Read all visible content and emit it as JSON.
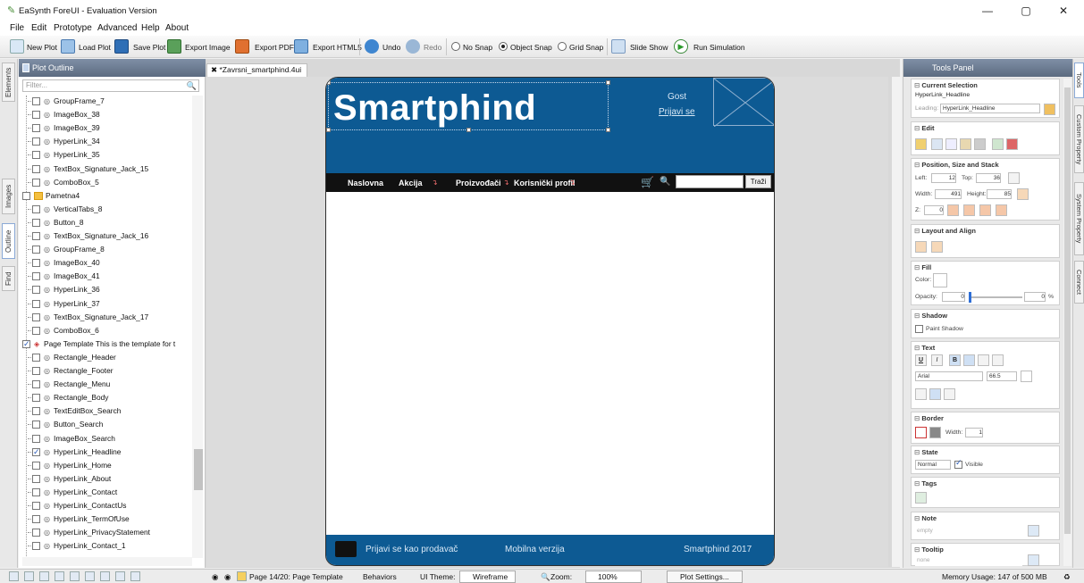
{
  "window": {
    "app_title": "EaSynth ForeUI - Evaluation Version",
    "minimize": "—",
    "maximize": "▢",
    "close": "✕"
  },
  "menu": [
    "File",
    "Edit",
    "Prototype",
    "Advanced",
    "Help",
    "About"
  ],
  "toolbar": {
    "new_plot": "New Plot",
    "load_plot": "Load Plot",
    "save_plot": "Save Plot",
    "export_image": "Export Image",
    "export_pdf": "Export PDF",
    "export_html5": "Export HTML5",
    "undo": "Undo",
    "redo": "Redo",
    "no_snap": "No Snap",
    "object_snap": "Object Snap",
    "grid_snap": "Grid Snap",
    "snap_selected": "Object Snap",
    "slide_show": "Slide Show",
    "run_simulation": "Run Simulation"
  },
  "left_tabs": [
    "Elements",
    "Images",
    "Outline",
    "Find"
  ],
  "outline": {
    "title": "Plot Outline",
    "filter_placeholder": "Filter...",
    "items": [
      {
        "label": "GroupFrame_7",
        "level": 1,
        "checked": false,
        "kind": "el"
      },
      {
        "label": "ImageBox_38",
        "level": 1,
        "checked": false,
        "kind": "el"
      },
      {
        "label": "ImageBox_39",
        "level": 1,
        "checked": false,
        "kind": "el"
      },
      {
        "label": "HyperLink_34",
        "level": 1,
        "checked": false,
        "kind": "el"
      },
      {
        "label": "HyperLink_35",
        "level": 1,
        "checked": false,
        "kind": "el"
      },
      {
        "label": "TextBox_Signature_Jack_15",
        "level": 1,
        "checked": false,
        "kind": "el"
      },
      {
        "label": "ComboBox_5",
        "level": 1,
        "checked": false,
        "kind": "el"
      },
      {
        "label": "Pametna4",
        "level": 0,
        "checked": false,
        "kind": "page"
      },
      {
        "label": "VerticalTabs_8",
        "level": 1,
        "checked": false,
        "kind": "el"
      },
      {
        "label": "Button_8",
        "level": 1,
        "checked": false,
        "kind": "el"
      },
      {
        "label": "TextBox_Signature_Jack_16",
        "level": 1,
        "checked": false,
        "kind": "el"
      },
      {
        "label": "GroupFrame_8",
        "level": 1,
        "checked": false,
        "kind": "el"
      },
      {
        "label": "ImageBox_40",
        "level": 1,
        "checked": false,
        "kind": "el"
      },
      {
        "label": "ImageBox_41",
        "level": 1,
        "checked": false,
        "kind": "el"
      },
      {
        "label": "HyperLink_36",
        "level": 1,
        "checked": false,
        "kind": "el"
      },
      {
        "label": "HyperLink_37",
        "level": 1,
        "checked": false,
        "kind": "el"
      },
      {
        "label": "TextBox_Signature_Jack_17",
        "level": 1,
        "checked": false,
        "kind": "el"
      },
      {
        "label": "ComboBox_6",
        "level": 1,
        "checked": false,
        "kind": "el"
      },
      {
        "label": "Page Template  This is the template for t",
        "level": 0,
        "checked": true,
        "kind": "template"
      },
      {
        "label": "Rectangle_Header",
        "level": 1,
        "checked": false,
        "kind": "el"
      },
      {
        "label": "Rectangle_Footer",
        "level": 1,
        "checked": false,
        "kind": "el"
      },
      {
        "label": "Rectangle_Menu",
        "level": 1,
        "checked": false,
        "kind": "el"
      },
      {
        "label": "Rectangle_Body",
        "level": 1,
        "checked": false,
        "kind": "el"
      },
      {
        "label": "TextEditBox_Search",
        "level": 1,
        "checked": false,
        "kind": "el"
      },
      {
        "label": "Button_Search",
        "level": 1,
        "checked": false,
        "kind": "el"
      },
      {
        "label": "ImageBox_Search",
        "level": 1,
        "checked": false,
        "kind": "el"
      },
      {
        "label": "HyperLink_Headline",
        "level": 1,
        "checked": true,
        "kind": "el"
      },
      {
        "label": "HyperLink_Home",
        "level": 1,
        "checked": false,
        "kind": "el"
      },
      {
        "label": "HyperLink_About",
        "level": 1,
        "checked": false,
        "kind": "el"
      },
      {
        "label": "HyperLink_Contact",
        "level": 1,
        "checked": false,
        "kind": "el"
      },
      {
        "label": "HyperLink_ContactUs",
        "level": 1,
        "checked": false,
        "kind": "el"
      },
      {
        "label": "HyperLink_TermOfUse",
        "level": 1,
        "checked": false,
        "kind": "el"
      },
      {
        "label": "HyperLink_PrivacyStatement",
        "level": 1,
        "checked": false,
        "kind": "el"
      },
      {
        "label": "HyperLink_Contact_1",
        "level": 1,
        "checked": false,
        "kind": "el"
      }
    ]
  },
  "document_tab": {
    "close": "✖",
    "label": "*Zavrsni_smartphind.4ui"
  },
  "mockup": {
    "headline": "Smartphind",
    "guest": "Gost",
    "login": "Prijavi se",
    "menu": [
      "Naslovna",
      "Akcija",
      "Proizvođači",
      "Korisnički profil"
    ],
    "search_button": "Traži",
    "footer_seller": "Prijavi se kao prodavač",
    "footer_mobile": "Mobilna verzija",
    "footer_copy": "Smartphind 2017",
    "header_color": "#0d5a93"
  },
  "tools": {
    "title": "Tools Panel",
    "current_selection": {
      "title": "Current Selection",
      "name": "HyperLink_Headline",
      "leading_label": "Leading:",
      "leading_value": "HyperLink_Headline"
    },
    "edit": {
      "title": "Edit"
    },
    "position": {
      "title": "Position, Size and Stack",
      "left_label": "Left:",
      "left": "12",
      "top_label": "Top:",
      "top": "36",
      "width_label": "Width:",
      "width": "491",
      "height_label": "Height:",
      "height": "85",
      "z_label": "Z:",
      "z": "0"
    },
    "layout": {
      "title": "Layout and Align"
    },
    "fill": {
      "title": "Fill",
      "color_label": "Color:",
      "opacity_label": "Opacity:",
      "opacity": "0",
      "opacity_right": "0",
      "percent": "%"
    },
    "shadow": {
      "title": "Shadow",
      "paint": "Paint Shadow"
    },
    "text": {
      "title": "Text",
      "font": "Arial",
      "size": "66.5",
      "u": "U",
      "i": "I",
      "b": "B"
    },
    "border": {
      "title": "Border",
      "width_label": "Width:",
      "width": "1"
    },
    "state": {
      "title": "State",
      "value": "Normal",
      "visible": "Visible"
    },
    "tags": {
      "title": "Tags"
    },
    "note": {
      "title": "Note",
      "value": "empty"
    },
    "tooltip": {
      "title": "Tooltip",
      "value": "none"
    }
  },
  "right_tabs": [
    "Tools",
    "Custom Property",
    "System Property",
    "Connect"
  ],
  "status": {
    "page": "Page 14/20: Page Template",
    "behaviors": "Behaviors",
    "theme_label": "UI Theme:",
    "theme": "Wireframe",
    "zoom_label": "Zoom:",
    "zoom": "100%",
    "plot_settings": "Plot Settings...",
    "memory": "Memory Usage: 147 of 500 MB"
  }
}
